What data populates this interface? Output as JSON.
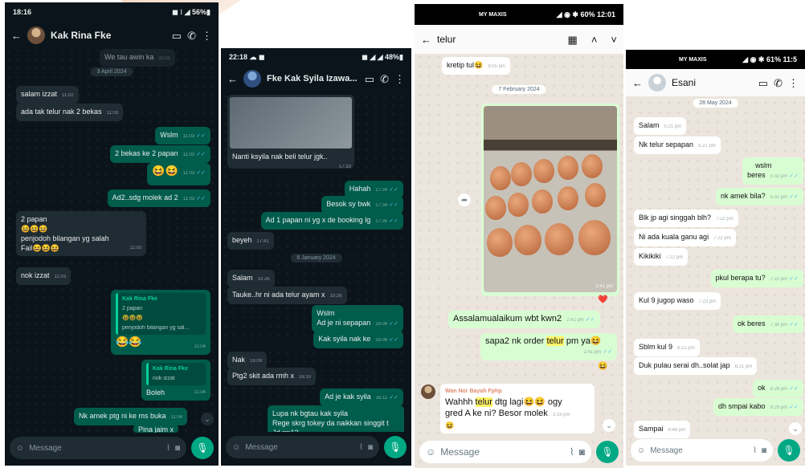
{
  "p1": {
    "status_time": "18:16",
    "status_right": "◼ ⁝ ◢ 56%▮",
    "title": "Kak Rina Fke",
    "partial_top": "We tau awin ka",
    "partial_top_time": "11:01",
    "date1": "3 April 2024",
    "msgs": [
      {
        "text": "salam izzat",
        "time": "11:02"
      },
      {
        "text": "ada tak telur nak 2 bekas",
        "time": "11:03"
      },
      {
        "text": "Wslm",
        "time": "11:03"
      },
      {
        "text": "2 bekas ke 2 papan",
        "time": "11:03"
      },
      {
        "text": "😆😆",
        "time": "11:03"
      },
      {
        "text": "Ad2..sdg molek ad 2",
        "time": "11:03"
      },
      {
        "text": "nok izzat",
        "time": "11:03"
      },
      {
        "text": "😂😂",
        "time": "11:04"
      },
      {
        "text": "Boleh",
        "time": "11:04"
      },
      {
        "text": "Nk amek ptg ni ke ms buka",
        "time": "11:04"
      },
      {
        "text": "Pina jaim x",
        "time": ""
      }
    ],
    "multi": {
      "line1": "2 papan",
      "line2": "😆😆😆",
      "line3": "penjodoh bilangan yg salah",
      "line4": "Fail😆😆😆",
      "time": "11:03"
    },
    "quote1": {
      "name": "Kak Rina Fke",
      "line1": "2 papan",
      "line2": "😆😆😆",
      "line3": "penjodoh bilangan yg sal..."
    },
    "quote2": {
      "name": "Kak Rina Fke",
      "text": "nok izzat"
    },
    "placeholder": "Message"
  },
  "p2": {
    "status_time": "22:18 ☁ ◼",
    "status_right": "◼ ◢ ◢ 48%▮",
    "title": "Fke Kak Syila Izawa...",
    "blurred_caption": "Nanti ksyila nak beli telur jgk..",
    "blurred_time": "17:33",
    "msgs": [
      {
        "text": "Hahah",
        "time": "17:34"
      },
      {
        "text": "Besok sy bwk",
        "time": "17:34"
      },
      {
        "text": "Ad 1 papan ni yg x de booking lg",
        "time": "17:35"
      },
      {
        "text": "beyeh",
        "time": "17:41"
      },
      {
        "text": "Salam",
        "time": "10:26"
      },
      {
        "text": "Tauke..hr ni ada telur ayam x",
        "time": "10:26"
      },
      {
        "text": "Kak syila nak ke",
        "time": "16:09"
      },
      {
        "text": "Nak",
        "time": "16:09"
      },
      {
        "text": "Ptg2 skit ada rmh x",
        "time": "16:10"
      },
      {
        "text": "Ad je kak syila",
        "time": "16:11"
      }
    ],
    "date1": "6 January 2024",
    "wslm": {
      "line1": "Wslm",
      "line2": "Ad je ni sepapan",
      "time": "16:09"
    },
    "last": {
      "line1": "Lupa nk bgtau kak syila",
      "line2": "Rege skrg tokey da naikkan singgit t",
      "line3": "Jd rm13"
    },
    "placeholder": "Message"
  },
  "p3": {
    "status_left": "MY MAXIS",
    "status_right": "◢ ◉ ✱ 60% 12:01",
    "search_value": "telur",
    "partial": "kretip tul😆",
    "partial_time": "9:05 pm",
    "date1": "7 February 2024",
    "photo_time": "2:41 pm",
    "reaction": "❤️",
    "msg1": {
      "text": "Assalamualaikum wbt kwn2",
      "time": "2:41 pm"
    },
    "msg2": {
      "pre": "sapa2 nk order ",
      "hl": "telur",
      "post": " pm ya😆",
      "time": "2:41 pm"
    },
    "reaction2": "😆",
    "sender": "Wan Nor Bayah Fphp",
    "msg3": {
      "pre": "Wahhh ",
      "hl": "telur",
      "post": " dtg lagi😆😆 ogy",
      "line2": "gred A ke ni? Besor molek",
      "time": "3:18 pm",
      "line3": "😆"
    },
    "placeholder": "Message"
  },
  "p4": {
    "status_left": "MY MAXIS",
    "status_right": "◢ ◉ ✱ 61% 11:5",
    "title": "Esani",
    "date1": "28 May 2024",
    "msgs": [
      {
        "text": "Salam",
        "time": "5:21 pm"
      },
      {
        "text": "Nk telur sepapan",
        "time": "5:21 pm"
      },
      {
        "text": "nk amek bila?",
        "time": "5:32 pm"
      },
      {
        "text": "Blk jp agi singgah blh?",
        "time": "7:22 pm"
      },
      {
        "text": "Ni ada kuala ganu agi",
        "time": "7:22 pm"
      },
      {
        "text": "Kikikiki",
        "time": "7:22 pm"
      },
      {
        "text": "pkul berapa tu?",
        "time": "7:22 pm"
      },
      {
        "text": "Kul 9 jugop waso",
        "time": "7:23 pm"
      },
      {
        "text": "ok beres",
        "time": "7:38 pm"
      },
      {
        "text": "Sblm kul 9",
        "time": "8:21 pm"
      },
      {
        "text": "Duk pulau serai dh..solat jap",
        "time": "8:21 pm"
      },
      {
        "text": "ok",
        "time": "8:28 pm"
      },
      {
        "text": "dh smpai kabo",
        "time": "8:29 pm"
      },
      {
        "text": "Sampai",
        "time": "8:48 pm"
      }
    ],
    "wslm": {
      "line1": "wslm",
      "line2": "beres",
      "time": "5:32 pm"
    },
    "placeholder": "Message"
  }
}
